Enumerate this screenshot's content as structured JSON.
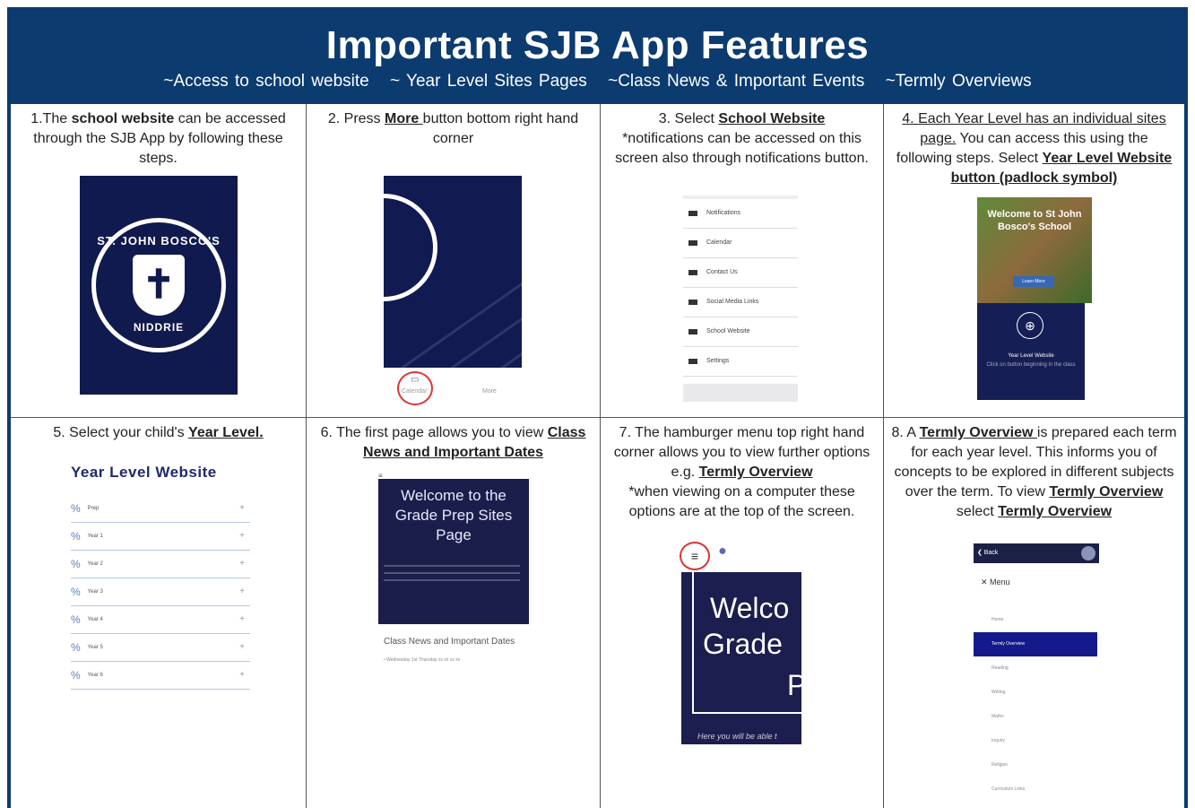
{
  "header": {
    "title": "Important SJB App Features",
    "subtitle_items": [
      "~Access to school website",
      "~ Year Level Sites Pages",
      "~Class News & Important Events",
      "~Termly Overviews"
    ]
  },
  "steps": {
    "s1": {
      "pre": "1.The ",
      "bold": "school website",
      "post": " can be accessed through the SJB App by following these steps."
    },
    "s2": {
      "pre": "2. Press ",
      "bold": "More ",
      "post": "button bottom right hand corner"
    },
    "s3": {
      "pre": "3. Select ",
      "bold": "School Website",
      "post": "*notifications can be accessed on this screen also through notifications button."
    },
    "s4": {
      "u1": "4. Each Year Level has an individual sites page.",
      "mid": " You can access this using the following steps. Select ",
      "bold": "Year Level Website button (padlock symbol)"
    },
    "s5": {
      "pre": "5. Select your child's ",
      "bold": "Year Level."
    },
    "s6": {
      "pre": "6. The first page allows you to view ",
      "bold": "Class News and Important Dates"
    },
    "s7": {
      "pre": "7. The hamburger menu top right hand corner allows you to view further options e.g. ",
      "bold": "Termly Overview",
      "post": "*when viewing on a computer these options are at the top of the screen."
    },
    "s8": {
      "pre": "8. A ",
      "bold1": "Termly Overview ",
      "mid": "is prepared each term for each year level. This informs you of concepts to be explored in different subjects over the term.  To view ",
      "bold2": "Termly Overview ",
      "mid2": "select ",
      "bold3": "Termly Overview"
    }
  },
  "logo": {
    "top": "ST. JOHN BOSCO'S",
    "bottom": "NIDDRIE",
    "cross": "✝"
  },
  "phone2": {
    "tab1": "Calendar",
    "tab2": "More",
    "ico": "▭"
  },
  "menu3": {
    "items": [
      "Notifications",
      "Calendar",
      "Contact Us",
      "Social Media Links",
      "School Website",
      "Settings"
    ]
  },
  "site4": {
    "photo_text": "Welcome to St John Bosco's School",
    "btn": "Learn More",
    "lock": "⊕",
    "line1": "Year Level Website",
    "line2": "Click on button beginning in the class"
  },
  "yl5": {
    "title": "Year Level Website",
    "rows": [
      "Prep",
      "Year 1",
      "Year 2",
      "Year 3",
      "Year 4",
      "Year 5",
      "Year 6"
    ]
  },
  "c6": {
    "top": "≡",
    "hero_title": "Welcome to the Grade Prep Sites Page",
    "news_title": "Class News and Important Dates",
    "news_bullet": "•  Wednesday 1st Thursday xx xx xx xx"
  },
  "c7": {
    "ham": "≡",
    "pin": "●",
    "w": "Welco",
    "g": "Grade",
    "p": "P",
    "cap": "Here you will be able t"
  },
  "c8": {
    "back": "❮ Back",
    "menu": "✕  Menu",
    "items": [
      "Home",
      "Termly Overview",
      "Reading",
      "Writing",
      "Maths",
      "Inquiry",
      "Religion",
      "Curriculum Links"
    ]
  }
}
